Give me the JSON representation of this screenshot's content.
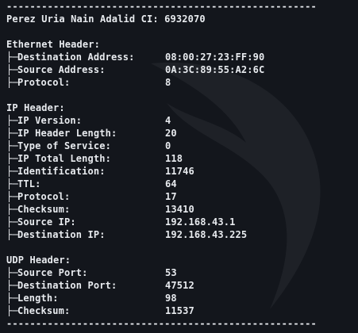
{
  "separator": "-----------------------------------------------------",
  "title": "Perez Uria Nain Adalid CI: 6932070",
  "tree_glyph": "├─",
  "sections": [
    {
      "header": "Ethernet Header:",
      "fields": [
        {
          "key": "Destination Address:",
          "value": "08:00:27:23:FF:90"
        },
        {
          "key": "Source Address:",
          "value": "0A:3C:89:55:A2:6C"
        },
        {
          "key": "Protocol:",
          "value": "8"
        }
      ]
    },
    {
      "header": "IP Header:",
      "fields": [
        {
          "key": "IP Version:",
          "value": "4"
        },
        {
          "key": "IP Header Length:",
          "value": "20"
        },
        {
          "key": "Type of Service:",
          "value": "0"
        },
        {
          "key": "IP Total Length:",
          "value": "118"
        },
        {
          "key": "Identification:",
          "value": "11746"
        },
        {
          "key": "TTL:",
          "value": "64"
        },
        {
          "key": "Protocol:",
          "value": "17"
        },
        {
          "key": "Checksum:",
          "value": "13410"
        },
        {
          "key": "Source IP:",
          "value": "192.168.43.1"
        },
        {
          "key": "Destination IP:",
          "value": "192.168.43.225"
        }
      ]
    },
    {
      "header": "UDP Header:",
      "fields": [
        {
          "key": "Source Port:",
          "value": "53"
        },
        {
          "key": "Destination Port:",
          "value": "47512"
        },
        {
          "key": "Length:",
          "value": "98"
        },
        {
          "key": "Checksum:",
          "value": "11537"
        }
      ]
    }
  ]
}
